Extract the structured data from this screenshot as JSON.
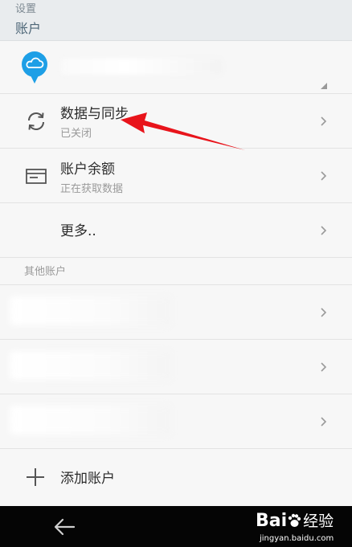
{
  "header": {
    "crumb": "设置",
    "title": "账户"
  },
  "rows": [
    {
      "icon": "sync-icon",
      "title": "数据与同步",
      "subtitle": "已关闭"
    },
    {
      "icon": "card-icon",
      "title": "账户余额",
      "subtitle": "正在获取数据"
    },
    {
      "title": "更多.."
    }
  ],
  "section": {
    "other_accounts": "其他账户"
  },
  "add_account": {
    "label": "添加账户"
  },
  "watermark": {
    "brand_prefix": "Bai",
    "brand_suffix": "经验",
    "url": "jingyan.baidu.com"
  },
  "colors": {
    "cloud_blue": "#1e9fe6",
    "arrow_red": "#e8141b",
    "header_bg": "#e9ecee"
  }
}
